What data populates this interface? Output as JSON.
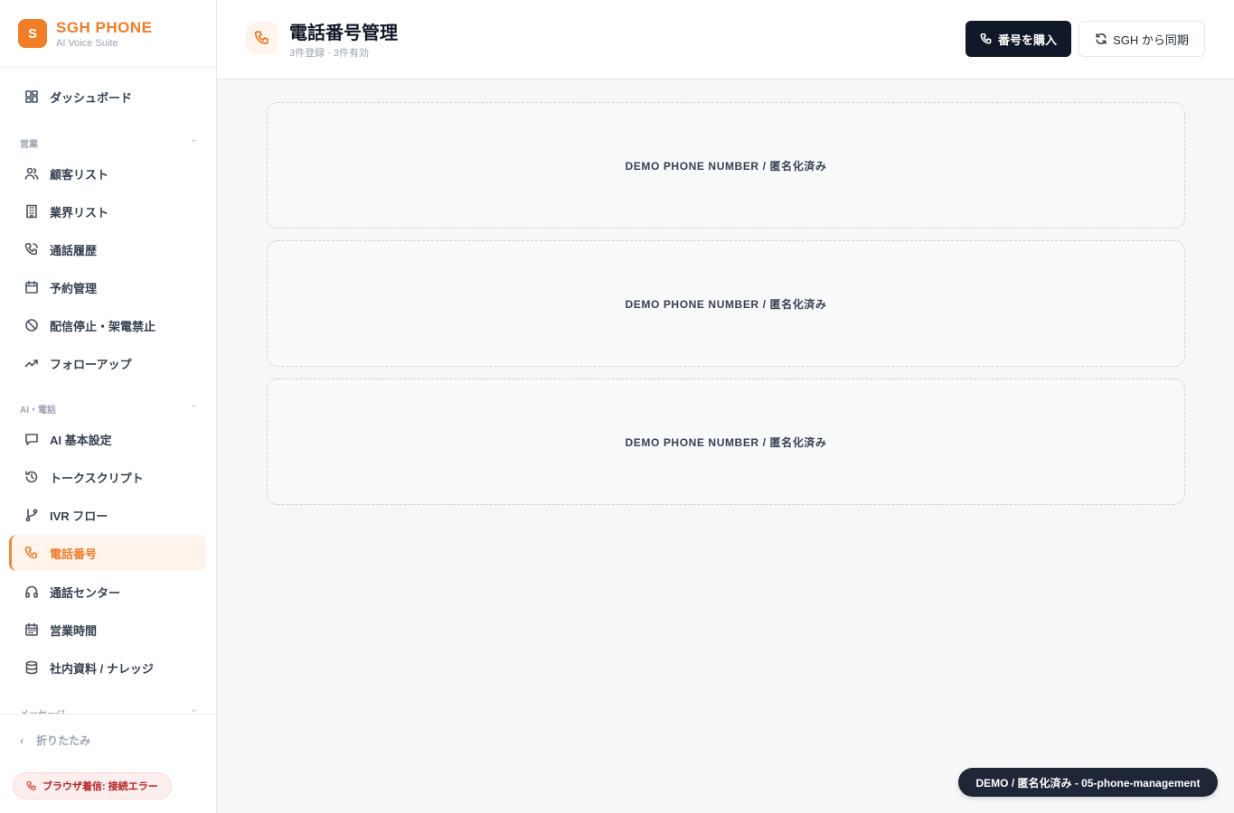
{
  "brand": {
    "logo_letter": "S",
    "name": "SGH PHONE",
    "subtitle": "AI Voice Suite"
  },
  "nav": {
    "dashboard": "ダッシュボード",
    "section_sales": "営業",
    "customers": "顧客リスト",
    "industries": "業界リスト",
    "call_history": "通話履歴",
    "reservations": "予約管理",
    "do_not_call": "配信停止・架電禁止",
    "follow_up": "フォローアップ",
    "section_ai": "AI・電話",
    "ai_settings": "AI 基本設定",
    "talk_script": "トークスクリプト",
    "ivr_flow": "IVR フロー",
    "phone_numbers": "電話番号",
    "call_center": "通話センター",
    "business_hours": "営業時間",
    "knowledge": "社内資料 / ナレッジ",
    "section_messages": "メッセージ"
  },
  "sidebar_bottom": {
    "collapse": "折りたたみ",
    "call_status": "ブラウザ着信: 接続エラー"
  },
  "header": {
    "title": "電話番号管理",
    "subtitle": "3件登録 · 3件有効",
    "buy_button": "番号を購入",
    "sync_button": "SGH から同期"
  },
  "cards": [
    "DEMO PHONE NUMBER / 匿名化済み",
    "DEMO PHONE NUMBER / 匿名化済み",
    "DEMO PHONE NUMBER / 匿名化済み"
  ],
  "demo_badge": "DEMO / 匿名化済み - 05-phone-management",
  "colors": {
    "accent": "#f27d27",
    "dark": "#111827",
    "error": "#b42323"
  }
}
